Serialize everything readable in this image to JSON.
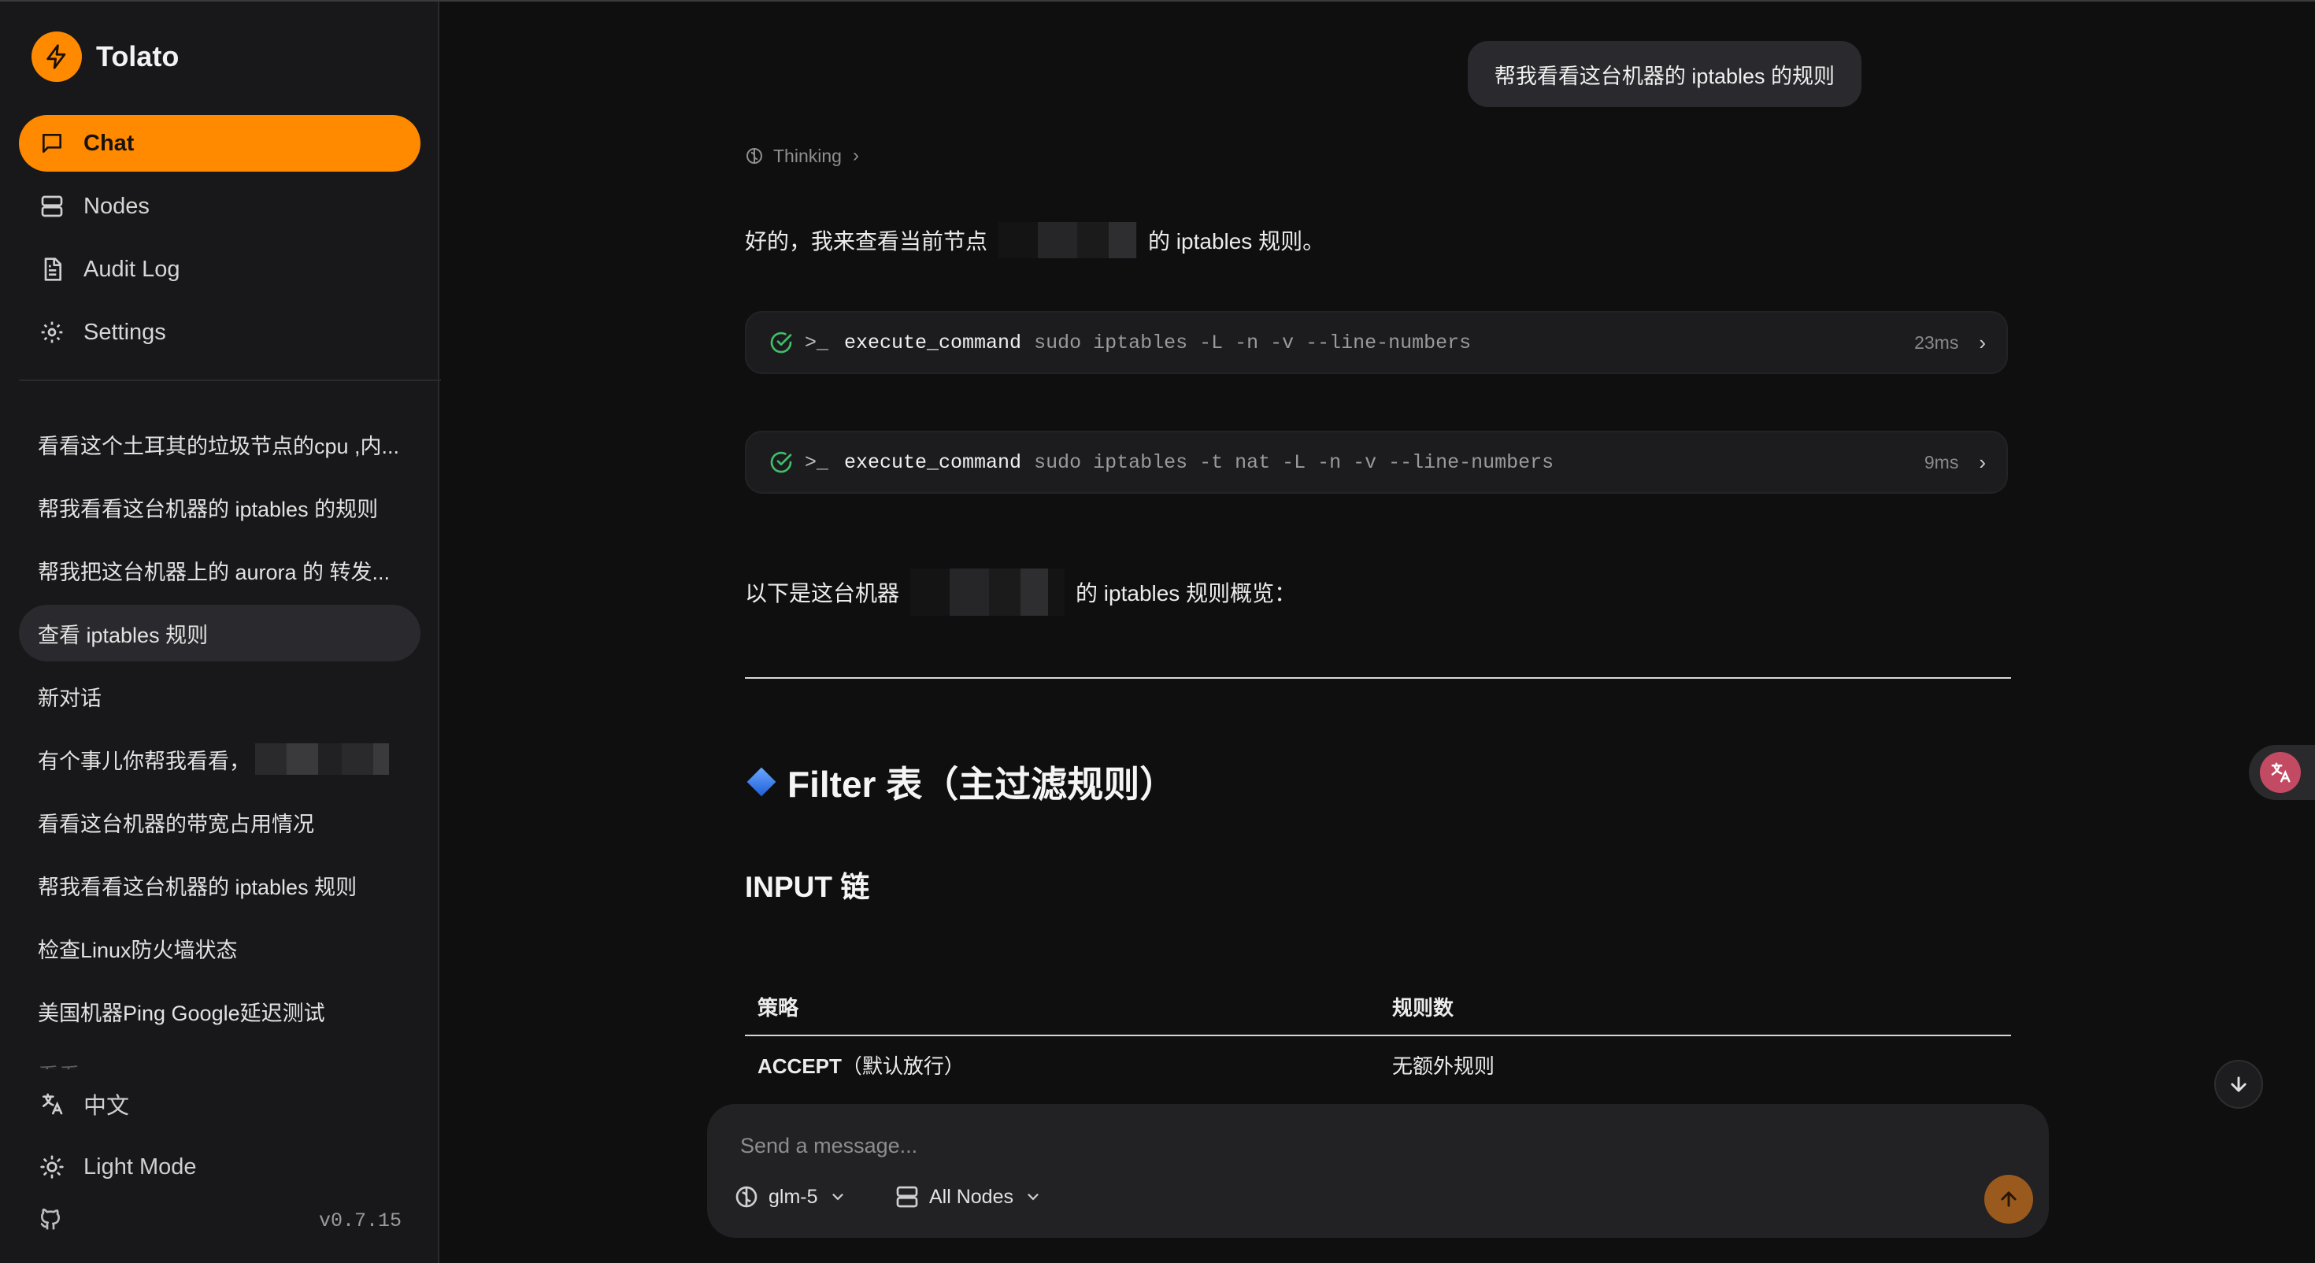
{
  "app": {
    "name": "Tolato",
    "accent": "#ff8a00"
  },
  "nav": [
    {
      "label": "Chat",
      "icon": "message-square-icon",
      "active": true
    },
    {
      "label": "Nodes",
      "icon": "server-icon",
      "active": false
    },
    {
      "label": "Audit Log",
      "icon": "file-text-icon",
      "active": false
    },
    {
      "label": "Settings",
      "icon": "gear-icon",
      "active": false
    }
  ],
  "history": [
    "看看这个土耳其的垃圾节点的cpu ,内...",
    "帮我看看这台机器的 iptables 的规则",
    "帮我把这台机器上的 aurora 的 转发...",
    "查看 iptables 规则",
    "新对话",
    "有个事儿你帮我看看，",
    "看看这台机器的带宽占用情况",
    "帮我看看这台机器的 iptables 规则",
    "检查Linux防火墙状态",
    "美国机器Ping Google延迟测试",
    "看看 ..."
  ],
  "sidebar_bottom": {
    "language": "中文",
    "theme": "Light Mode",
    "version": "v0.7.15"
  },
  "chat": {
    "user_message": "帮我看看这台机器的 iptables 的规则",
    "thinking_label": "Thinking",
    "reply_intro_prefix": "好的，我来查看当前节点",
    "reply_intro_suffix": "的 iptables 规则。",
    "commands": [
      {
        "tool": "execute_command",
        "prompt": ">_",
        "args": "sudo iptables -L -n -v --line-numbers",
        "time": "23ms"
      },
      {
        "tool": "execute_command",
        "prompt": ">_",
        "args": "sudo iptables -t nat -L -n -v --line-numbers",
        "time": "9ms"
      }
    ],
    "overview_prefix": "以下是这台机器",
    "overview_suffix": "的 iptables 规则概览：",
    "section_heading": "Filter 表（主过滤规则）",
    "subsection_heading": "INPUT 链",
    "table": {
      "headers": [
        "策略",
        "规则数"
      ],
      "rows": [
        {
          "policy_bold": "ACCEPT",
          "policy_note": "（默认放行）",
          "count": "无额外规则"
        }
      ]
    }
  },
  "composer": {
    "placeholder": "Send a message...",
    "model": "glm-5",
    "nodes": "All Nodes"
  }
}
